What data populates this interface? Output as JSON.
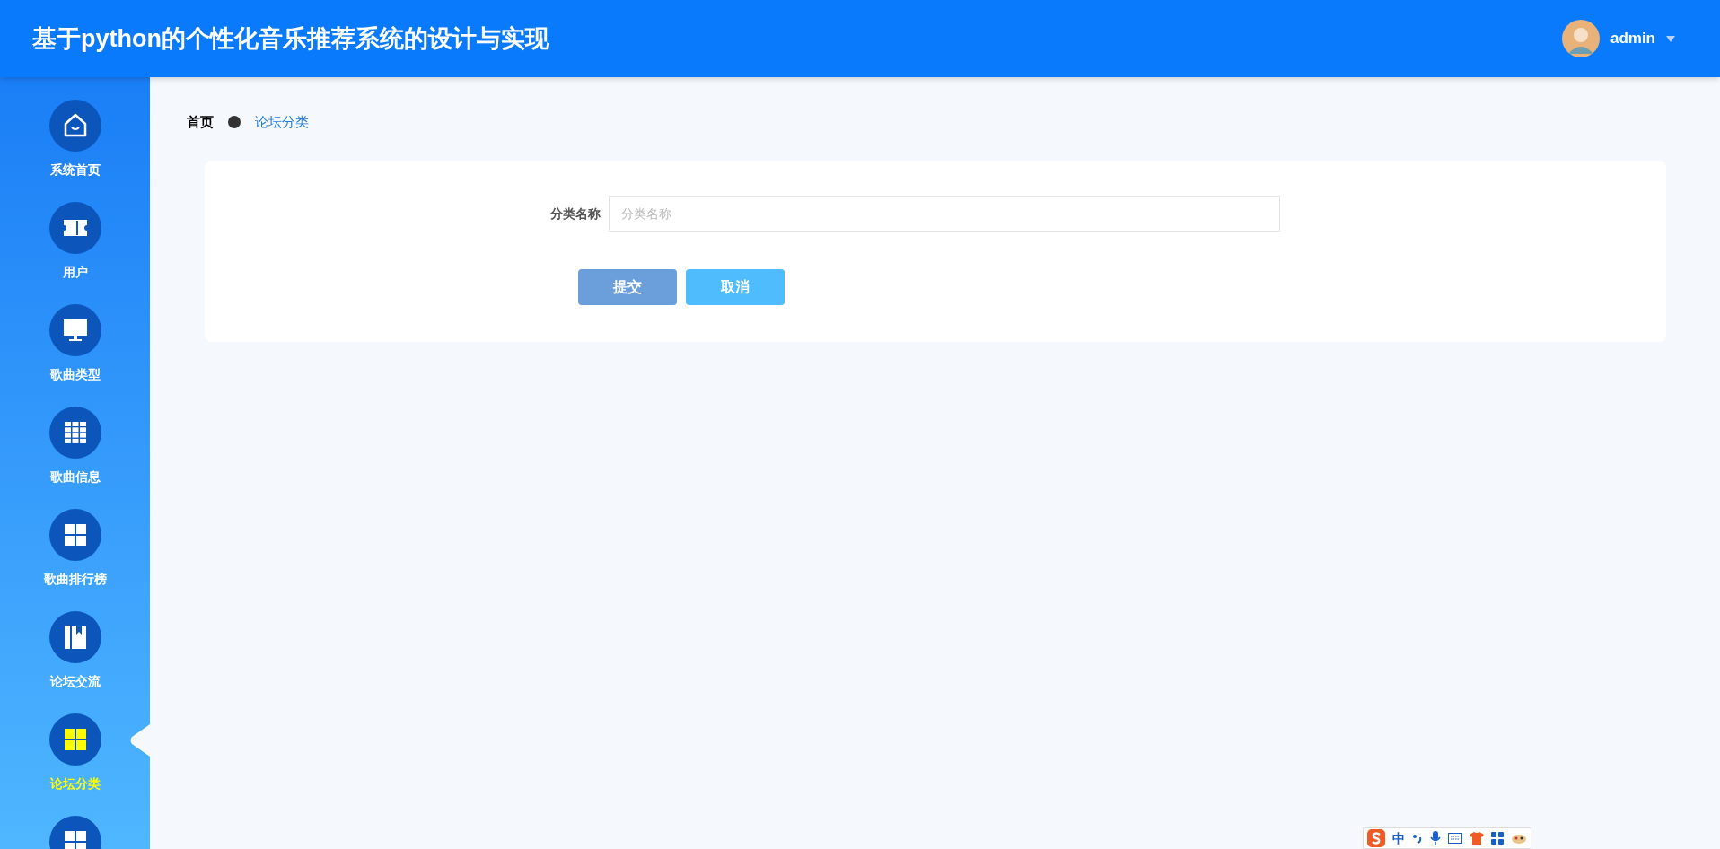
{
  "header": {
    "title": "基于python的个性化音乐推荐系统的设计与实现",
    "user": "admin"
  },
  "sidebar": {
    "items": [
      {
        "label": "系统首页",
        "selected": false
      },
      {
        "label": "用户",
        "selected": false
      },
      {
        "label": "歌曲类型",
        "selected": false
      },
      {
        "label": "歌曲信息",
        "selected": false
      },
      {
        "label": "歌曲排行榜",
        "selected": false
      },
      {
        "label": "论坛交流",
        "selected": false
      },
      {
        "label": "论坛分类",
        "selected": true
      },
      {
        "selected": false
      }
    ]
  },
  "breadcrumb": [
    "首页",
    "论坛分类"
  ],
  "form": {
    "field": {
      "label": "分类名称",
      "placeholder": "分类名称"
    },
    "buttons": [
      {
        "label": "提交",
        "kind": "submit"
      },
      {
        "label": "取消",
        "kind": "cancel"
      }
    ]
  },
  "ime_toolbar": {
    "mode": "中"
  }
}
